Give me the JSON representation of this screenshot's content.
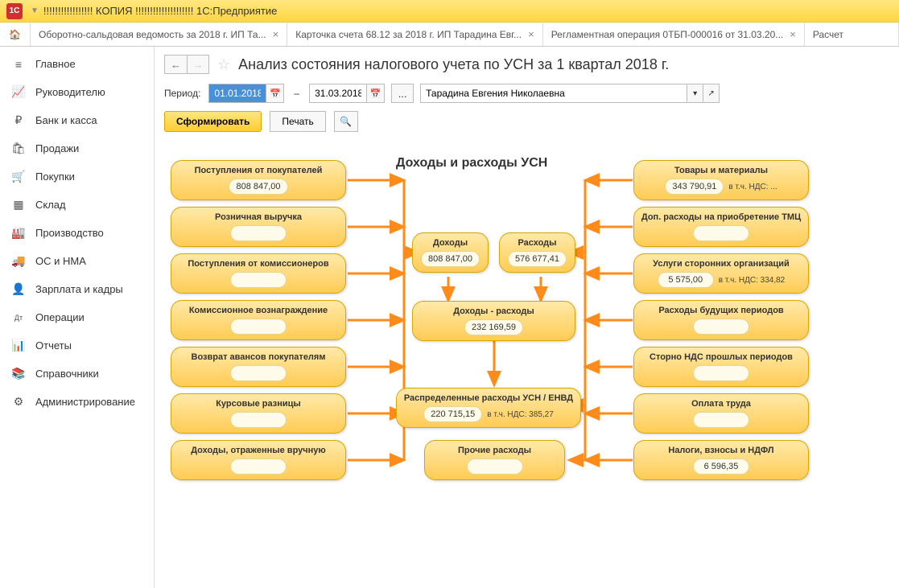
{
  "titlebar": {
    "logo": "1С",
    "text": "!!!!!!!!!!!!!!!!! КОПИЯ !!!!!!!!!!!!!!!!!!!!  1С:Предприятие"
  },
  "tabs": [
    {
      "label": "Оборотно-сальдовая ведомость за 2018 г. ИП Та..."
    },
    {
      "label": "Карточка счета 68.12 за 2018 г. ИП Тарадина Евг..."
    },
    {
      "label": "Регламентная операция 0ТБП-000016 от 31.03.20..."
    },
    {
      "label": "Расчет"
    }
  ],
  "sidebar": {
    "items": [
      {
        "icon": "≡",
        "label": "Главное"
      },
      {
        "icon": "📈",
        "label": "Руководителю"
      },
      {
        "icon": "₽",
        "label": "Банк и касса"
      },
      {
        "icon": "🛍",
        "label": "Продажи"
      },
      {
        "icon": "🛒",
        "label": "Покупки"
      },
      {
        "icon": "▦",
        "label": "Склад"
      },
      {
        "icon": "🏭",
        "label": "Производство"
      },
      {
        "icon": "🚚",
        "label": "ОС и НМА"
      },
      {
        "icon": "👤",
        "label": "Зарплата и кадры"
      },
      {
        "icon": "Дт",
        "label": "Операции"
      },
      {
        "icon": "📊",
        "label": "Отчеты"
      },
      {
        "icon": "📚",
        "label": "Справочники"
      },
      {
        "icon": "⚙",
        "label": "Администрирование"
      }
    ]
  },
  "header": {
    "title": "Анализ состояния налогового учета по УСН за 1 квартал 2018 г."
  },
  "toolbar": {
    "period_label": "Период:",
    "date_from": "01.01.2018",
    "date_to": "31.03.2018",
    "person": "Тарадина Евгения Николаевна"
  },
  "actions": {
    "generate": "Сформировать",
    "print": "Печать"
  },
  "diagram": {
    "main_title": "Доходы и расходы УСН",
    "left_col": [
      {
        "title": "Поступления от покупателей",
        "value": "808 847,00"
      },
      {
        "title": "Розничная выручка",
        "value": ""
      },
      {
        "title": "Поступления от комиссионеров",
        "value": ""
      },
      {
        "title": "Комиссионное вознаграждение",
        "value": ""
      },
      {
        "title": "Возврат авансов покупателям",
        "value": ""
      },
      {
        "title": "Курсовые разницы",
        "value": ""
      },
      {
        "title": "Доходы, отраженные вручную",
        "value": ""
      }
    ],
    "center": {
      "income": {
        "title": "Доходы",
        "value": "808 847,00"
      },
      "expense": {
        "title": "Расходы",
        "value": "576 677,41"
      },
      "diff": {
        "title": "Доходы - расходы",
        "value": "232 169,59"
      },
      "distributed": {
        "title": "Распределенные расходы УСН / ЕНВД",
        "value": "220 715,15",
        "note": "в т.ч. НДС: 385,27"
      },
      "other": {
        "title": "Прочие расходы",
        "value": ""
      }
    },
    "right_col": [
      {
        "title": "Товары и материалы",
        "value": "343 790,91",
        "note": "в т.ч. НДС: ..."
      },
      {
        "title": "Доп. расходы на приобретение ТМЦ",
        "value": ""
      },
      {
        "title": "Услуги сторонних организаций",
        "value": "5 575,00",
        "note": "в т.ч. НДС: 334,82"
      },
      {
        "title": "Расходы будущих периодов",
        "value": ""
      },
      {
        "title": "Сторно НДС прошлых периодов",
        "value": ""
      },
      {
        "title": "Оплата труда",
        "value": ""
      },
      {
        "title": "Налоги, взносы и НДФЛ",
        "value": "6 596,35"
      }
    ]
  }
}
